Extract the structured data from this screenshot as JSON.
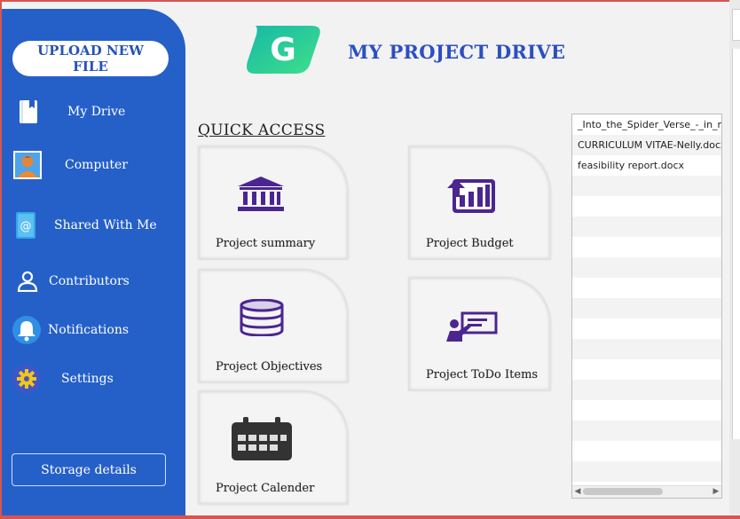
{
  "sidebar": {
    "upload_label": "UPLOAD NEW FILE",
    "items": [
      {
        "label": "My Drive",
        "icon": "book-icon"
      },
      {
        "label": "Computer",
        "icon": "person-avatar-icon"
      },
      {
        "label": "Shared With Me",
        "icon": "contact-book-icon"
      },
      {
        "label": "Contributors",
        "icon": "user-icon"
      },
      {
        "label": "Notifications",
        "icon": "bell-icon"
      },
      {
        "label": "Settings",
        "icon": "gear-icon"
      }
    ],
    "storage_label": "Storage details"
  },
  "header": {
    "logo_letter": "G",
    "title": "MY PROJECT DRIVE"
  },
  "quick_access": {
    "title": "QUICK ACCESS",
    "cards": [
      {
        "label": "Project summary",
        "icon": "bank-icon"
      },
      {
        "label": "Project Budget",
        "icon": "bar-chart-icon"
      },
      {
        "label": "Project Objectives",
        "icon": "database-icon"
      },
      {
        "label": "Project ToDo Items",
        "icon": "presentation-icon"
      },
      {
        "label": "Project Calender",
        "icon": "calendar-icon"
      }
    ]
  },
  "files": {
    "items": [
      "_Into_the_Spider_Verse_-_in_re",
      "CURRICULUM VITAE-Nelly.docx",
      "feasibility report.docx"
    ]
  },
  "colors": {
    "sidebar": "#2560c8",
    "title": "#2b4fbf",
    "icon_purple": "#4b2590",
    "logo_green": "#2ad39a"
  }
}
